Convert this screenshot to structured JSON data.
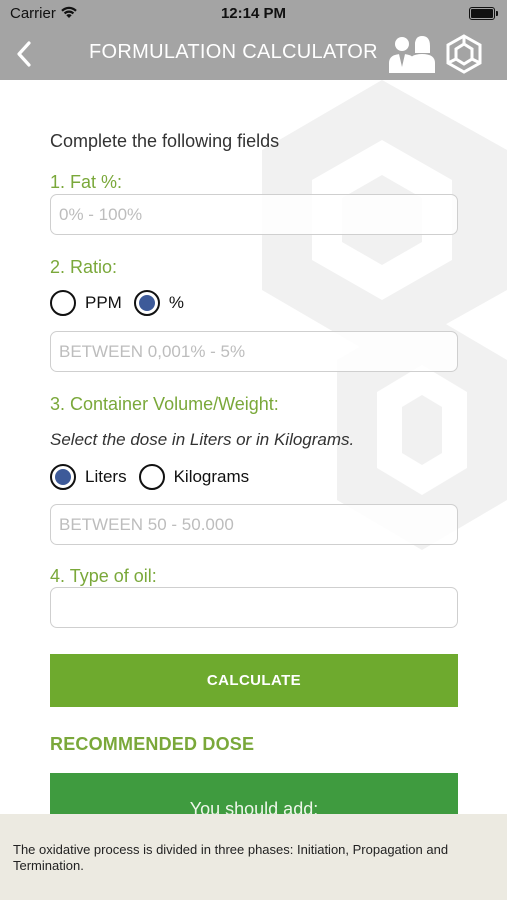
{
  "status": {
    "carrier": "Carrier",
    "time": "12:14 PM"
  },
  "nav": {
    "title": "FORMULATION CALCULATOR",
    "back_icon": "chevron-left-icon",
    "team_icon": "team-icon",
    "settings_icon": "hexagon-logo-icon"
  },
  "form": {
    "intro": "Complete the following fields",
    "fat": {
      "label": "1. Fat %:",
      "placeholder": "0% - 100%"
    },
    "ratio": {
      "label": "2. Ratio:",
      "options": [
        "PPM",
        "%"
      ],
      "selected": "%",
      "placeholder": "BETWEEN 0,001% - 5%"
    },
    "container": {
      "label": "3. Container Volume/Weight:",
      "hint": "Select the dose in Liters or in Kilograms.",
      "options": [
        "Liters",
        "Kilograms"
      ],
      "selected": "Liters",
      "placeholder": "BETWEEN 50 - 50.000"
    },
    "oil": {
      "label": "4. Type of oil:",
      "value": ""
    },
    "calculate_label": "CALCULATE"
  },
  "result": {
    "title": "RECOMMENDED DOSE",
    "text": "You should add:"
  },
  "footer": {
    "tip": "The oxidative process is divided in three phases: Initiation, Propagation and Termination."
  },
  "colors": {
    "brand_green": "#6eaa2e",
    "label_green": "#7aa83a",
    "result_green": "#3f9b3f",
    "radio_selected": "#3d5a99",
    "navbar": "#a4a4a4"
  }
}
